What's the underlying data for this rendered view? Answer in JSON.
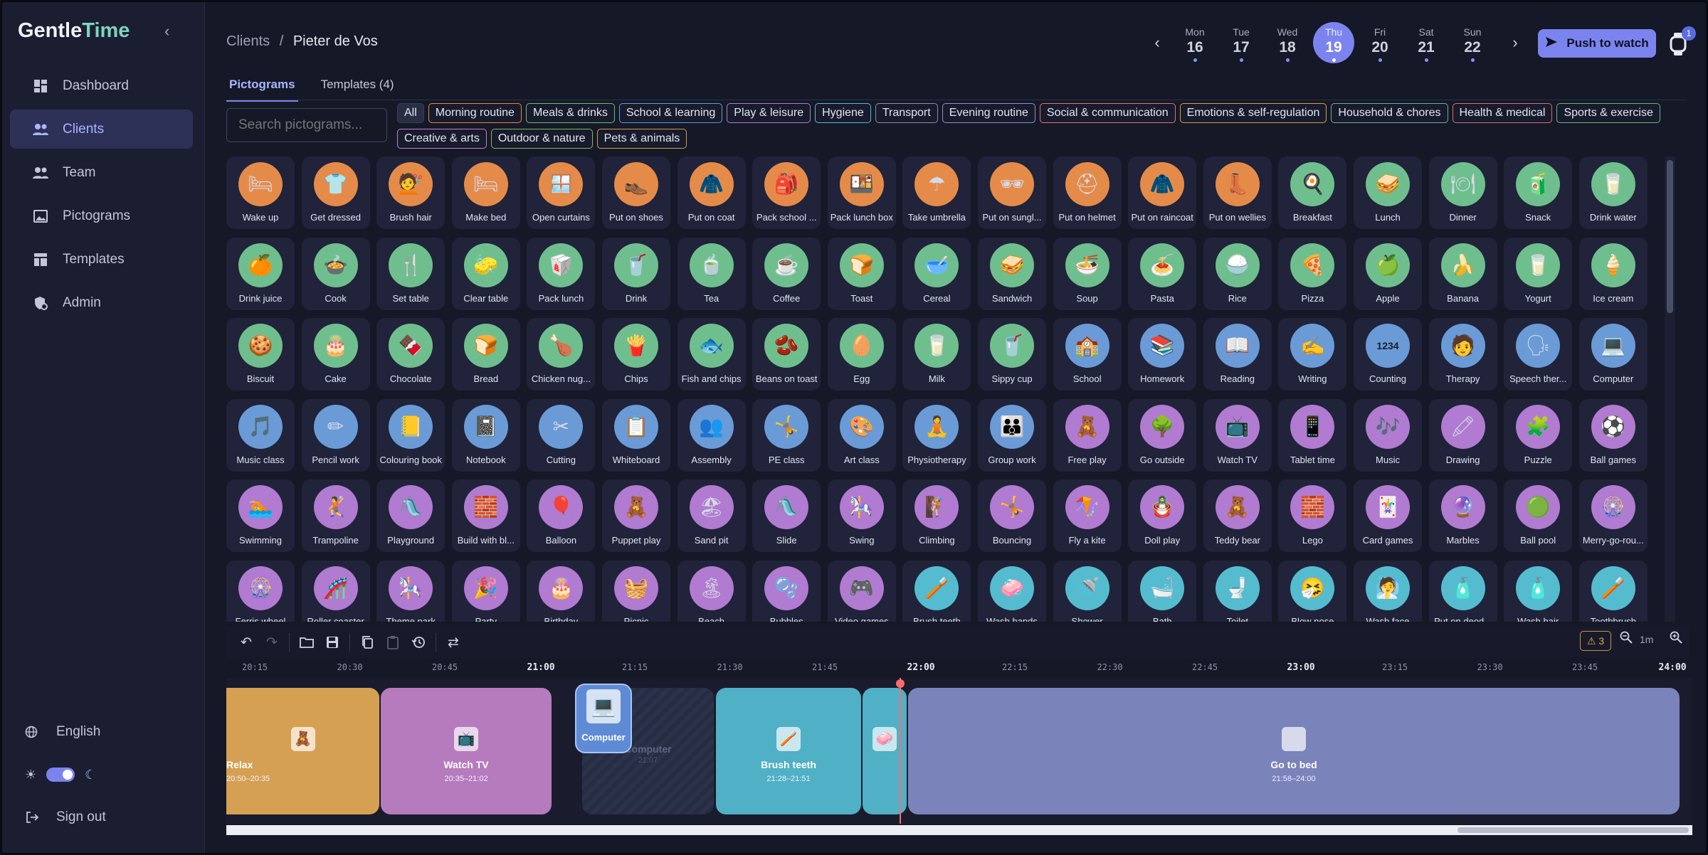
{
  "app": {
    "logo_gentle": "Gentle",
    "logo_time": "Time"
  },
  "nav": [
    {
      "label": "Dashboard",
      "icon": "dashboard-icon"
    },
    {
      "label": "Clients",
      "icon": "people-icon",
      "active": true
    },
    {
      "label": "Team",
      "icon": "team-icon"
    },
    {
      "label": "Pictograms",
      "icon": "image-icon"
    },
    {
      "label": "Templates",
      "icon": "template-icon"
    },
    {
      "label": "Admin",
      "icon": "admin-icon"
    }
  ],
  "sidebar_bottom": {
    "language": "English",
    "sign_out": "Sign out"
  },
  "breadcrumb": {
    "root": "Clients",
    "sep": "/",
    "current": "Pieter de Vos"
  },
  "week": [
    {
      "name": "Mon",
      "num": "16"
    },
    {
      "name": "Tue",
      "num": "17"
    },
    {
      "name": "Wed",
      "num": "18"
    },
    {
      "name": "Thu",
      "num": "19",
      "active": true
    },
    {
      "name": "Fri",
      "num": "20"
    },
    {
      "name": "Sat",
      "num": "21"
    },
    {
      "name": "Sun",
      "num": "22"
    }
  ],
  "push_button": "Push to watch",
  "watch_badge": "1",
  "tabs": [
    "Pictograms",
    "Templates (4)"
  ],
  "search": {
    "placeholder": "Search pictograms..."
  },
  "categories": [
    {
      "label": "All",
      "color": "#3a3e56"
    },
    {
      "label": "Morning routine",
      "color": "#e2883c"
    },
    {
      "label": "Meals & drinks",
      "color": "#6dbb7a"
    },
    {
      "label": "School & learning",
      "color": "#5b9ad8"
    },
    {
      "label": "Play & leisure",
      "color": "#b07bd0"
    },
    {
      "label": "Hygiene",
      "color": "#55bcd0"
    },
    {
      "label": "Transport",
      "color": "#8a8ea6"
    },
    {
      "label": "Evening routine",
      "color": "#8d8fd6"
    },
    {
      "label": "Social & communication",
      "color": "#e07272"
    },
    {
      "label": "Emotions & self-regulation",
      "color": "#d8a040"
    },
    {
      "label": "Household & chores",
      "color": "#6cb095"
    },
    {
      "label": "Health & medical",
      "color": "#d36b7a"
    },
    {
      "label": "Sports & exercise",
      "color": "#62b57a"
    },
    {
      "label": "Creative & arts",
      "color": "#c87fd2"
    },
    {
      "label": "Outdoor & nature",
      "color": "#7cbb62"
    },
    {
      "label": "Pets & animals",
      "color": "#d49a4e"
    }
  ],
  "pictograms": [
    [
      {
        "l": "Wake up",
        "g": "🛏",
        "c": "#e58b4a"
      },
      {
        "l": "Get dressed",
        "g": "👕",
        "c": "#e58b4a"
      },
      {
        "l": "Brush hair",
        "g": "💇",
        "c": "#e58b4a"
      },
      {
        "l": "Make bed",
        "g": "🛏",
        "c": "#e58b4a"
      },
      {
        "l": "Open curtains",
        "g": "🪟",
        "c": "#e58b4a"
      },
      {
        "l": "Put on shoes",
        "g": "👞",
        "c": "#e58b4a"
      },
      {
        "l": "Put on coat",
        "g": "🧥",
        "c": "#e58b4a"
      },
      {
        "l": "Pack school ...",
        "g": "🎒",
        "c": "#e58b4a"
      },
      {
        "l": "Pack lunch box",
        "g": "🍱",
        "c": "#e58b4a"
      },
      {
        "l": "Take umbrella",
        "g": "☂",
        "c": "#e58b4a"
      },
      {
        "l": "Put on sungl...",
        "g": "🕶",
        "c": "#e58b4a"
      },
      {
        "l": "Put on helmet",
        "g": "⛑",
        "c": "#e58b4a"
      },
      {
        "l": "Put on raincoat",
        "g": "🧥",
        "c": "#e58b4a"
      },
      {
        "l": "Put on wellies",
        "g": "👢",
        "c": "#e58b4a"
      },
      {
        "l": "Breakfast",
        "g": "🍳",
        "c": "#6fbf8e"
      },
      {
        "l": "Lunch",
        "g": "🥪",
        "c": "#6fbf8e"
      },
      {
        "l": "Dinner",
        "g": "🍽",
        "c": "#6fbf8e"
      },
      {
        "l": "Snack",
        "g": "🧃",
        "c": "#6fbf8e"
      },
      {
        "l": "Drink water",
        "g": "🥛",
        "c": "#6fbf8e"
      }
    ],
    [
      {
        "l": "Drink juice",
        "g": "🍊",
        "c": "#6fbf8e"
      },
      {
        "l": "Cook",
        "g": "🍲",
        "c": "#6fbf8e"
      },
      {
        "l": "Set table",
        "g": "🍴",
        "c": "#6fbf8e"
      },
      {
        "l": "Clear table",
        "g": "🧽",
        "c": "#6fbf8e"
      },
      {
        "l": "Pack lunch",
        "g": "🥡",
        "c": "#6fbf8e"
      },
      {
        "l": "Drink",
        "g": "🥤",
        "c": "#6fbf8e"
      },
      {
        "l": "Tea",
        "g": "🍵",
        "c": "#6fbf8e"
      },
      {
        "l": "Coffee",
        "g": "☕",
        "c": "#6fbf8e"
      },
      {
        "l": "Toast",
        "g": "🍞",
        "c": "#6fbf8e"
      },
      {
        "l": "Cereal",
        "g": "🥣",
        "c": "#6fbf8e"
      },
      {
        "l": "Sandwich",
        "g": "🥪",
        "c": "#6fbf8e"
      },
      {
        "l": "Soup",
        "g": "🍜",
        "c": "#6fbf8e"
      },
      {
        "l": "Pasta",
        "g": "🍝",
        "c": "#6fbf8e"
      },
      {
        "l": "Rice",
        "g": "🍚",
        "c": "#6fbf8e"
      },
      {
        "l": "Pizza",
        "g": "🍕",
        "c": "#6fbf8e"
      },
      {
        "l": "Apple",
        "g": "🍏",
        "c": "#6fbf8e"
      },
      {
        "l": "Banana",
        "g": "🍌",
        "c": "#6fbf8e"
      },
      {
        "l": "Yogurt",
        "g": "🥛",
        "c": "#6fbf8e"
      },
      {
        "l": "Ice cream",
        "g": "🍦",
        "c": "#6fbf8e"
      }
    ],
    [
      {
        "l": "Biscuit",
        "g": "🍪",
        "c": "#6fbf8e"
      },
      {
        "l": "Cake",
        "g": "🎂",
        "c": "#6fbf8e"
      },
      {
        "l": "Chocolate",
        "g": "🍫",
        "c": "#6fbf8e"
      },
      {
        "l": "Bread",
        "g": "🍞",
        "c": "#6fbf8e"
      },
      {
        "l": "Chicken nug...",
        "g": "🍗",
        "c": "#6fbf8e"
      },
      {
        "l": "Chips",
        "g": "🍟",
        "c": "#6fbf8e"
      },
      {
        "l": "Fish and chips",
        "g": "🐟",
        "c": "#6fbf8e"
      },
      {
        "l": "Beans on toast",
        "g": "🫘",
        "c": "#6fbf8e"
      },
      {
        "l": "Egg",
        "g": "🥚",
        "c": "#6fbf8e"
      },
      {
        "l": "Milk",
        "g": "🥛",
        "c": "#6fbf8e"
      },
      {
        "l": "Sippy cup",
        "g": "🥤",
        "c": "#6fbf8e"
      },
      {
        "l": "School",
        "g": "🏫",
        "c": "#6a9bd6"
      },
      {
        "l": "Homework",
        "g": "📚",
        "c": "#6a9bd6"
      },
      {
        "l": "Reading",
        "g": "📖",
        "c": "#6a9bd6"
      },
      {
        "l": "Writing",
        "g": "✍",
        "c": "#6a9bd6"
      },
      {
        "l": "Counting",
        "g": "1234",
        "c": "#6a9bd6"
      },
      {
        "l": "Therapy",
        "g": "🧑",
        "c": "#6a9bd6"
      },
      {
        "l": "Speech ther...",
        "g": "🗣",
        "c": "#6a9bd6"
      },
      {
        "l": "Computer",
        "g": "💻",
        "c": "#6a9bd6"
      }
    ],
    [
      {
        "l": "Music class",
        "g": "🎵",
        "c": "#6a9bd6"
      },
      {
        "l": "Pencil work",
        "g": "✏",
        "c": "#6a9bd6"
      },
      {
        "l": "Colouring book",
        "g": "📒",
        "c": "#6a9bd6"
      },
      {
        "l": "Notebook",
        "g": "📓",
        "c": "#6a9bd6"
      },
      {
        "l": "Cutting",
        "g": "✂",
        "c": "#6a9bd6"
      },
      {
        "l": "Whiteboard",
        "g": "📋",
        "c": "#6a9bd6"
      },
      {
        "l": "Assembly",
        "g": "👥",
        "c": "#6a9bd6"
      },
      {
        "l": "PE class",
        "g": "🤸",
        "c": "#6a9bd6"
      },
      {
        "l": "Art class",
        "g": "🎨",
        "c": "#6a9bd6"
      },
      {
        "l": "Physiotherapy",
        "g": "🧘",
        "c": "#6a9bd6"
      },
      {
        "l": "Group work",
        "g": "👪",
        "c": "#6a9bd6"
      },
      {
        "l": "Free play",
        "g": "🧸",
        "c": "#b07bd0"
      },
      {
        "l": "Go outside",
        "g": "🌳",
        "c": "#b07bd0"
      },
      {
        "l": "Watch TV",
        "g": "📺",
        "c": "#b07bd0"
      },
      {
        "l": "Tablet time",
        "g": "📱",
        "c": "#b07bd0"
      },
      {
        "l": "Music",
        "g": "🎶",
        "c": "#b07bd0"
      },
      {
        "l": "Drawing",
        "g": "🖍",
        "c": "#b07bd0"
      },
      {
        "l": "Puzzle",
        "g": "🧩",
        "c": "#b07bd0"
      },
      {
        "l": "Ball games",
        "g": "⚽",
        "c": "#b07bd0"
      }
    ],
    [
      {
        "l": "Swimming",
        "g": "🏊",
        "c": "#b07bd0"
      },
      {
        "l": "Trampoline",
        "g": "🤾",
        "c": "#b07bd0"
      },
      {
        "l": "Playground",
        "g": "🛝",
        "c": "#b07bd0"
      },
      {
        "l": "Build with bl...",
        "g": "🧱",
        "c": "#b07bd0"
      },
      {
        "l": "Balloon",
        "g": "🎈",
        "c": "#b07bd0"
      },
      {
        "l": "Puppet play",
        "g": "🧸",
        "c": "#b07bd0"
      },
      {
        "l": "Sand pit",
        "g": "🏖",
        "c": "#b07bd0"
      },
      {
        "l": "Slide",
        "g": "🛝",
        "c": "#b07bd0"
      },
      {
        "l": "Swing",
        "g": "🎠",
        "c": "#b07bd0"
      },
      {
        "l": "Climbing",
        "g": "🧗",
        "c": "#b07bd0"
      },
      {
        "l": "Bouncing",
        "g": "🤸",
        "c": "#b07bd0"
      },
      {
        "l": "Fly a kite",
        "g": "🪁",
        "c": "#b07bd0"
      },
      {
        "l": "Doll play",
        "g": "🪆",
        "c": "#b07bd0"
      },
      {
        "l": "Teddy bear",
        "g": "🧸",
        "c": "#b07bd0"
      },
      {
        "l": "Lego",
        "g": "🧱",
        "c": "#b07bd0"
      },
      {
        "l": "Card games",
        "g": "🃏",
        "c": "#b07bd0"
      },
      {
        "l": "Marbles",
        "g": "🔮",
        "c": "#b07bd0"
      },
      {
        "l": "Ball pool",
        "g": "🟢",
        "c": "#b07bd0"
      },
      {
        "l": "Merry-go-rou...",
        "g": "🎡",
        "c": "#b07bd0"
      }
    ],
    [
      {
        "l": "Ferris wheel",
        "g": "🎡",
        "c": "#b07bd0"
      },
      {
        "l": "Roller coaster",
        "g": "🎢",
        "c": "#b07bd0"
      },
      {
        "l": "Theme park",
        "g": "🎠",
        "c": "#b07bd0"
      },
      {
        "l": "Party",
        "g": "🎉",
        "c": "#b07bd0"
      },
      {
        "l": "Birthday",
        "g": "🎂",
        "c": "#b07bd0"
      },
      {
        "l": "Picnic",
        "g": "🧺",
        "c": "#b07bd0"
      },
      {
        "l": "Beach",
        "g": "🏝",
        "c": "#b07bd0"
      },
      {
        "l": "Bubbles",
        "g": "🫧",
        "c": "#b07bd0"
      },
      {
        "l": "Video games",
        "g": "🎮",
        "c": "#b07bd0"
      },
      {
        "l": "Brush teeth",
        "g": "🪥",
        "c": "#55bcd0"
      },
      {
        "l": "Wash hands",
        "g": "🧼",
        "c": "#55bcd0"
      },
      {
        "l": "Shower",
        "g": "🚿",
        "c": "#55bcd0"
      },
      {
        "l": "Bath",
        "g": "🛁",
        "c": "#55bcd0"
      },
      {
        "l": "Toilet",
        "g": "🚽",
        "c": "#55bcd0"
      },
      {
        "l": "Blow nose",
        "g": "🤧",
        "c": "#55bcd0"
      },
      {
        "l": "Wash face",
        "g": "🧖",
        "c": "#55bcd0"
      },
      {
        "l": "Put on deod...",
        "g": "🧴",
        "c": "#55bcd0"
      },
      {
        "l": "Wash hair",
        "g": "🧴",
        "c": "#55bcd0"
      },
      {
        "l": "Toothbrush",
        "g": "🪥",
        "c": "#55bcd0"
      }
    ]
  ],
  "toolbar": {
    "warnings": "3",
    "zoom": "1m"
  },
  "ruler": [
    "20:15",
    "20:30",
    "20:45",
    "21:00",
    "21:15",
    "21:30",
    "21:45",
    "22:00",
    "22:15",
    "22:30",
    "22:45",
    "23:00",
    "23:15",
    "23:30",
    "23:45",
    "24:00"
  ],
  "ruler_major": [
    "21:00",
    "22:00",
    "23:00",
    "24:00"
  ],
  "timeline": {
    "blocks": [
      {
        "label": "Relax",
        "time": "20:50–20:35",
        "color": "#d6a052",
        "glyph": "🧸"
      },
      {
        "label": "Watch TV",
        "time": "20:35–21:02",
        "color": "#b67bbd",
        "glyph": "📺"
      },
      {
        "label": "Computer",
        "time": "21:07",
        "ghost": true
      },
      {
        "label": "Brush teeth",
        "time": "21:28–21:51",
        "color": "#4fb0c6",
        "glyph": "🪥"
      },
      {
        "label": "",
        "time": "",
        "color": "#4fb0c6",
        "glyph": "🧼"
      },
      {
        "label": "Go to bed",
        "time": "21:58–24:00",
        "color": "#7b83bb",
        "glyph": "🛏"
      }
    ],
    "dragging": {
      "label": "Computer",
      "glyph": "💻"
    }
  }
}
